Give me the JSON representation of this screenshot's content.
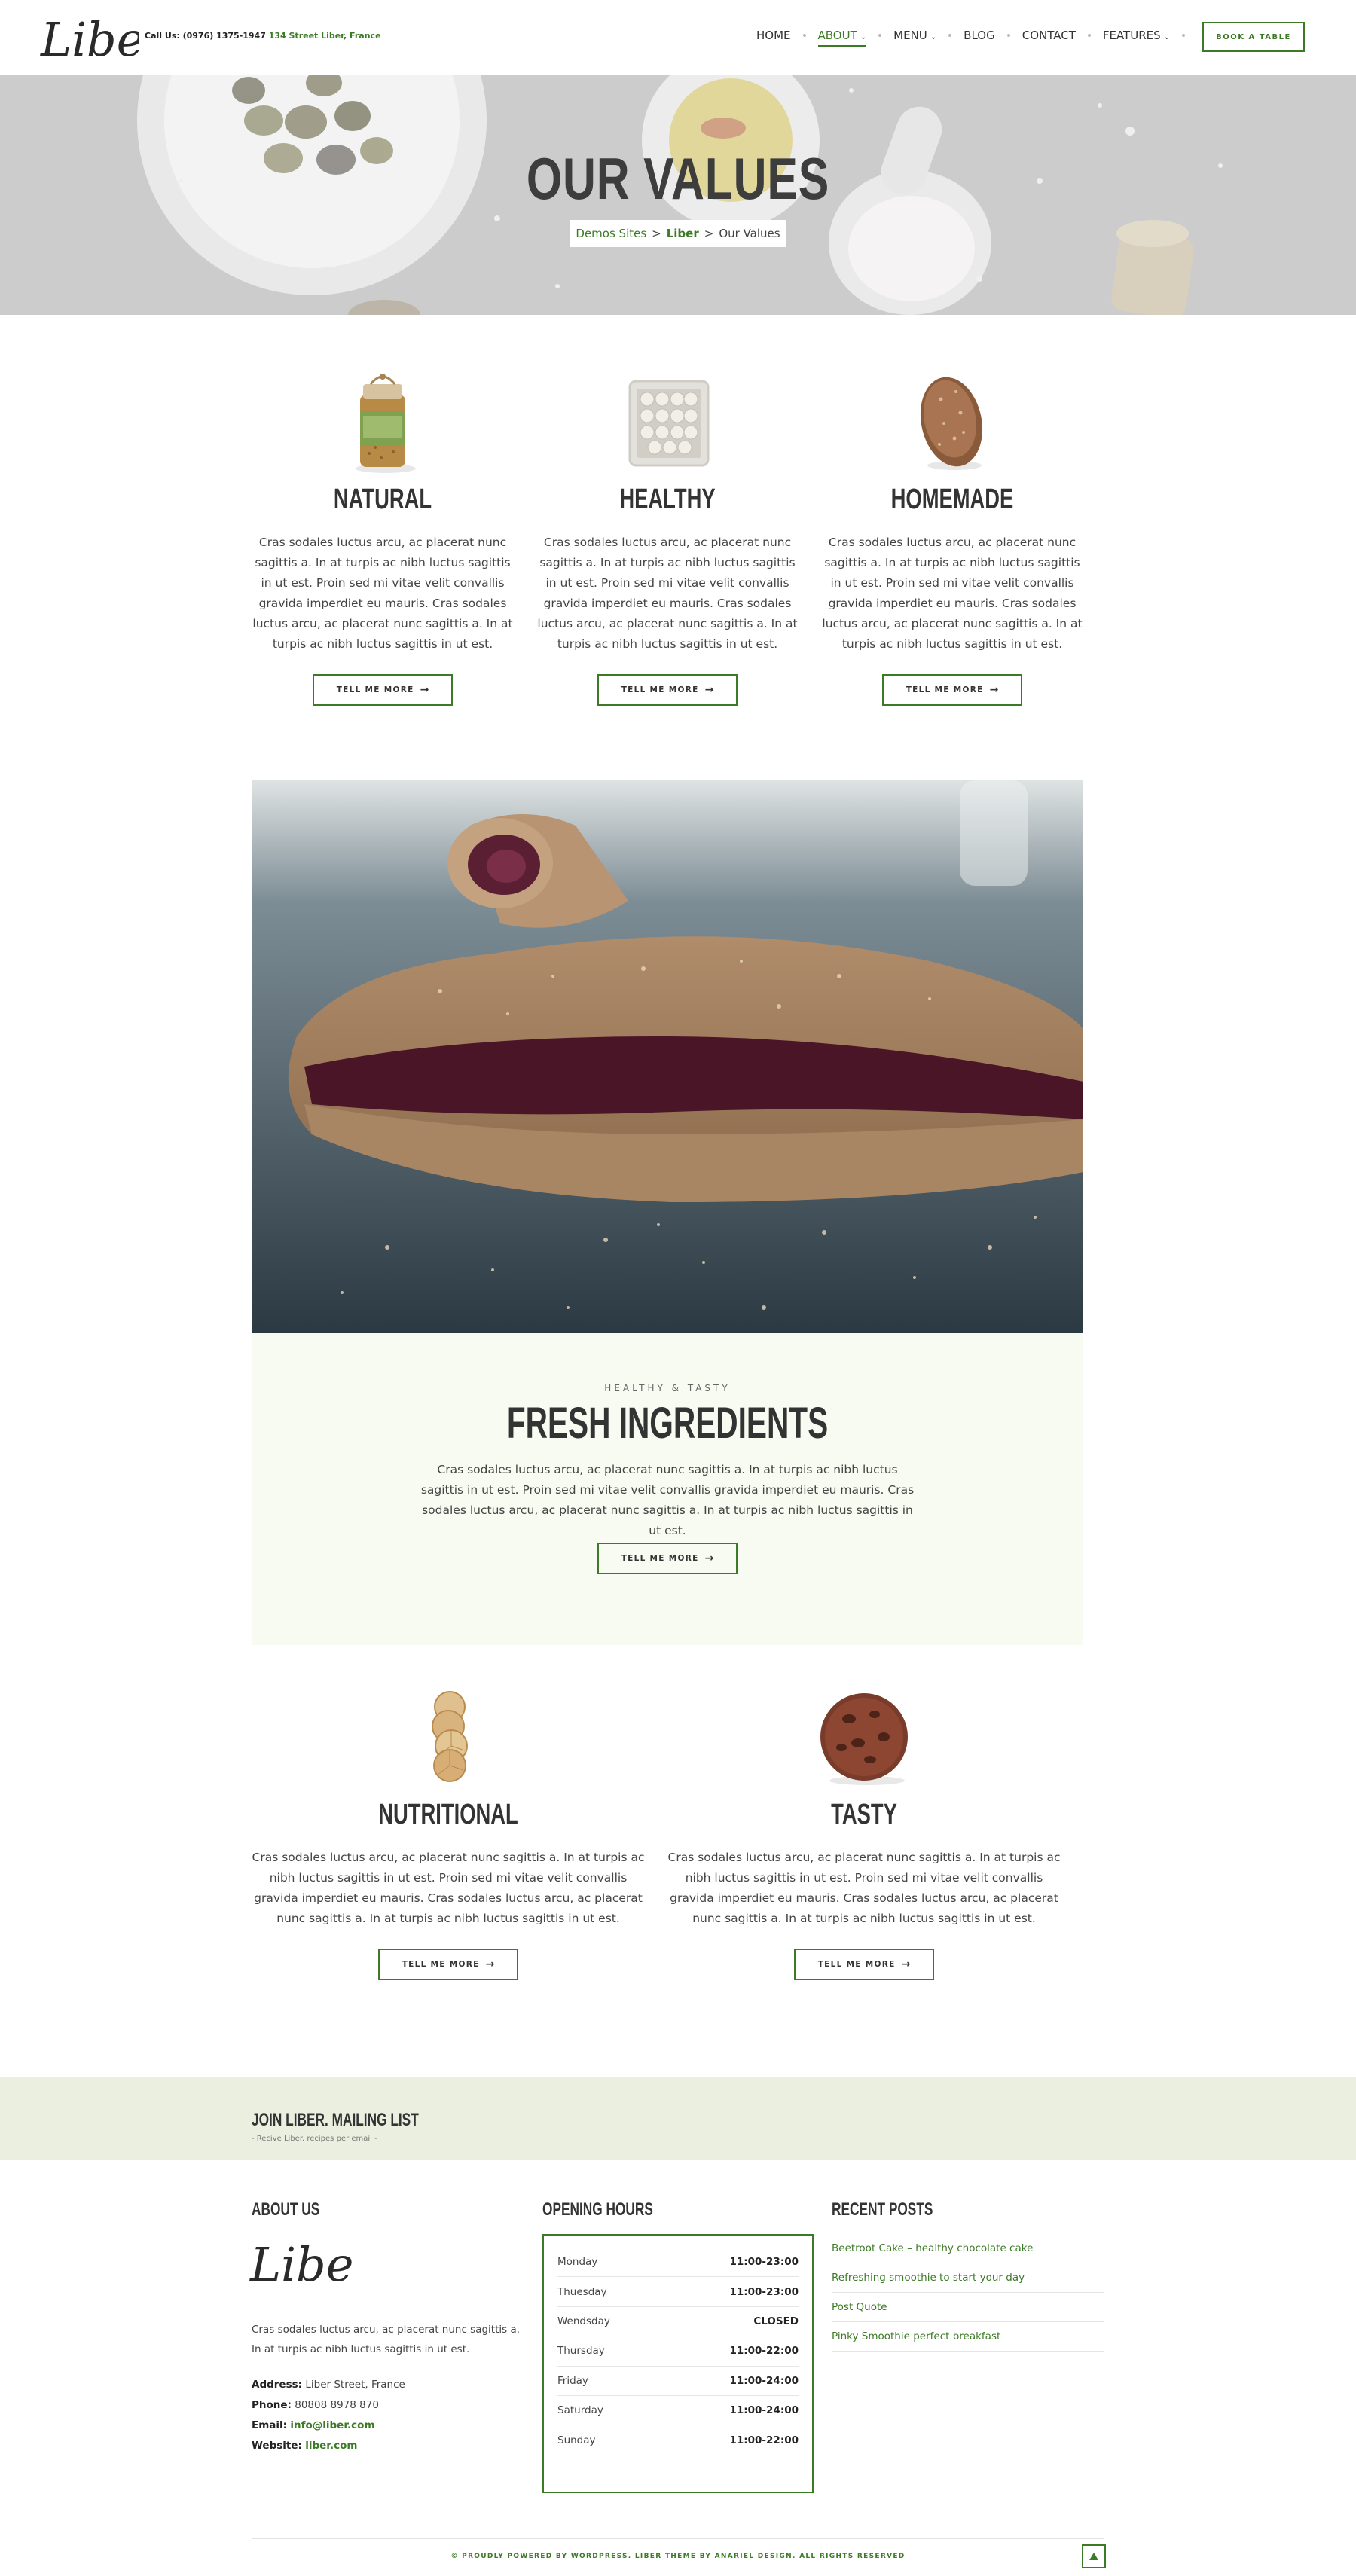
{
  "header": {
    "logo_text": "Liber.",
    "contact_label": "Call Us: (0976) 1375-1947",
    "contact_address": "134 Street Liber, France",
    "nav": [
      {
        "label": "HOME",
        "has_dropdown": false,
        "active": false
      },
      {
        "label": "ABOUT",
        "has_dropdown": true,
        "active": true
      },
      {
        "label": "MENU",
        "has_dropdown": true,
        "active": false
      },
      {
        "label": "BLOG",
        "has_dropdown": false,
        "active": false
      },
      {
        "label": "CONTACT",
        "has_dropdown": false,
        "active": false
      },
      {
        "label": "FEATURES",
        "has_dropdown": true,
        "active": false
      }
    ],
    "book_button": "BOOK A TABLE"
  },
  "hero": {
    "title": "OUR VALUES",
    "breadcrumb": [
      {
        "label": "Demos Sites"
      },
      {
        "label": "Liber"
      },
      {
        "label": "Our Values"
      }
    ],
    "separator": ">"
  },
  "values": [
    {
      "title": "NATURAL",
      "icon": "jar-icon",
      "text": "Cras sodales luctus arcu, ac placerat nunc sagittis a. In at turpis ac nibh luctus sagittis in ut est. Proin sed mi vitae velit convallis gravida imperdiet eu mauris. Cras sodales luctus arcu, ac placerat nunc sagittis a. In at turpis ac nibh luctus sagittis in ut est.",
      "button": "TELL ME MORE"
    },
    {
      "title": "HEALTHY",
      "icon": "tray-icon",
      "text": "Cras sodales luctus arcu, ac placerat nunc sagittis a. In at turpis ac nibh luctus sagittis in ut est. Proin sed mi vitae velit convallis gravida imperdiet eu mauris. Cras sodales luctus arcu, ac placerat nunc sagittis a. In at turpis ac nibh luctus sagittis in ut est.",
      "button": "TELL ME MORE"
    },
    {
      "title": "HOMEMADE",
      "icon": "bread-icon",
      "text": "Cras sodales luctus arcu, ac placerat nunc sagittis a. In at turpis ac nibh luctus sagittis in ut est. Proin sed mi vitae velit convallis gravida imperdiet eu mauris. Cras sodales luctus arcu, ac placerat nunc sagittis a. In at turpis ac nibh luctus sagittis in ut est.",
      "button": "TELL ME MORE"
    }
  ],
  "fresh": {
    "kicker": "HEALTHY & TASTY",
    "title": "FRESH INGREDIENTS",
    "text": "Cras sodales luctus arcu, ac placerat nunc sagittis a. In at turpis ac nibh luctus sagittis in ut est. Proin sed mi vitae velit convallis gravida imperdiet eu mauris. Cras sodales luctus arcu, ac placerat nunc sagittis a. In at turpis ac nibh luctus sagittis in ut est.",
    "button": "TELL ME MORE"
  },
  "values2": [
    {
      "title": "NUTRITIONAL",
      "icon": "dried-citrus-icon",
      "text": "Cras sodales luctus arcu, ac placerat nunc sagittis a. In at turpis ac nibh luctus sagittis in ut est. Proin sed mi vitae velit convallis gravida imperdiet eu mauris. Cras sodales luctus arcu, ac placerat nunc sagittis a. In at turpis ac nibh luctus sagittis in ut est.",
      "button": "TELL ME MORE"
    },
    {
      "title": "TASTY",
      "icon": "cookie-icon",
      "text": "Cras sodales luctus arcu, ac placerat nunc sagittis a. In at turpis ac nibh luctus sagittis in ut est. Proin sed mi vitae velit convallis gravida imperdiet eu mauris. Cras sodales luctus arcu, ac placerat nunc sagittis a. In at turpis ac nibh luctus sagittis in ut est.",
      "button": "TELL ME MORE"
    }
  ],
  "mailing": {
    "title": "JOIN LIBER. MAILING LIST",
    "subtitle": "- Recive Liber. recipes per email -"
  },
  "footer": {
    "about": {
      "heading": "ABOUT US",
      "logo_text": "Liber.",
      "text": "Cras sodales luctus arcu, ac placerat nunc sagittis a. In at turpis ac nibh luctus sagittis in ut est.",
      "address_label": "Address:",
      "address": "Liber Street, France",
      "phone_label": "Phone:",
      "phone": "80808 8978 870",
      "email_label": "Email:",
      "email": "info@liber.com",
      "website_label": "Website:",
      "website": "liber.com"
    },
    "hours": {
      "heading": "OPENING HOURS",
      "rows": [
        {
          "day": "Monday",
          "time": "11:00-23:00"
        },
        {
          "day": "Thuesday",
          "time": "11:00-23:00"
        },
        {
          "day": "Wendsday",
          "time": "CLOSED"
        },
        {
          "day": "Thursday",
          "time": "11:00-22:00"
        },
        {
          "day": "Friday",
          "time": "11:00-24:00"
        },
        {
          "day": "Saturday",
          "time": "11:00-24:00"
        },
        {
          "day": "Sunday",
          "time": "11:00-22:00"
        }
      ]
    },
    "posts": {
      "heading": "RECENT POSTS",
      "items": [
        "Beetroot Cake – healthy chocolate cake",
        "Refreshing smoothie to start your day",
        "Post Quote",
        "Pinky Smoothie perfect breakfast"
      ]
    },
    "copyright": "© PROUDLY POWERED BY WORDPRESS. LIBER THEME BY ANARIEL DESIGN. ALL RIGHTS RESERVED"
  },
  "colors": {
    "accent": "#3c7a26",
    "fresh_bg": "#f8fbf1",
    "mailing_bg": "#eaefe0"
  }
}
